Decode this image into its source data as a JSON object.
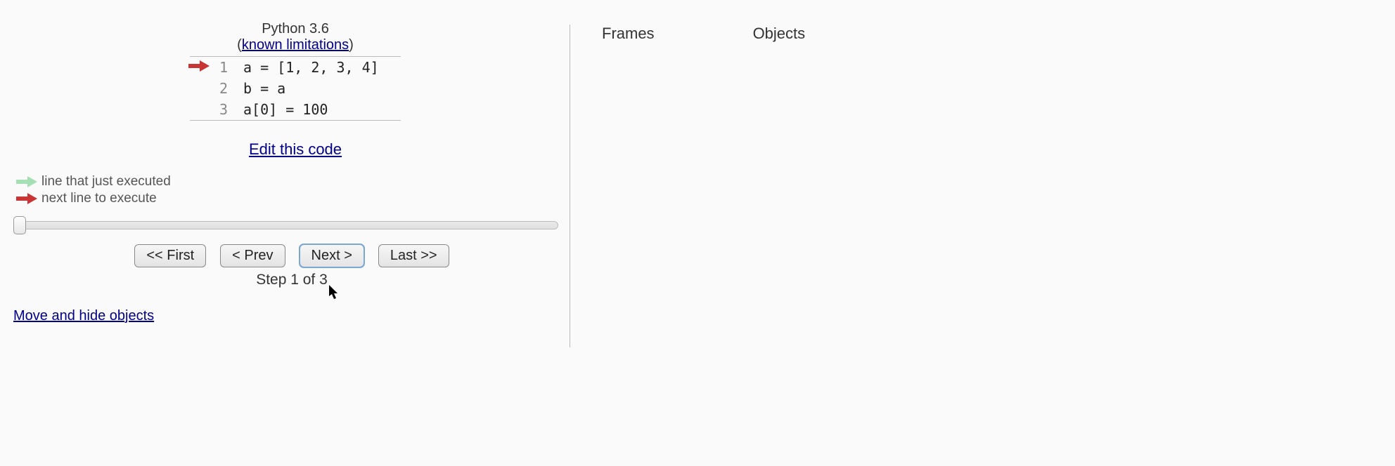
{
  "header": {
    "language": "Python 3.6",
    "limitations_prefix": "(",
    "limitations_text": "known limitations",
    "limitations_suffix": ")"
  },
  "code": {
    "lines": [
      {
        "n": "1",
        "text": "a = [1, 2, 3, 4]",
        "next": true,
        "just": false
      },
      {
        "n": "2",
        "text": "b = a",
        "next": false,
        "just": false
      },
      {
        "n": "3",
        "text": "a[0] = 100",
        "next": false,
        "just": false
      }
    ]
  },
  "edit_link": "Edit this code",
  "legend": {
    "just": "line that just executed",
    "next": "next line to execute"
  },
  "controls": {
    "first": "<< First",
    "prev": "< Prev",
    "next": "Next >",
    "last": "Last >>",
    "step": "Step 1 of 3"
  },
  "move_hide": "Move and hide objects",
  "vis": {
    "frames": "Frames",
    "objects": "Objects"
  },
  "colors": {
    "arrow_next": "#c93434",
    "arrow_just": "#a5e0b5",
    "link": "#00008b"
  }
}
